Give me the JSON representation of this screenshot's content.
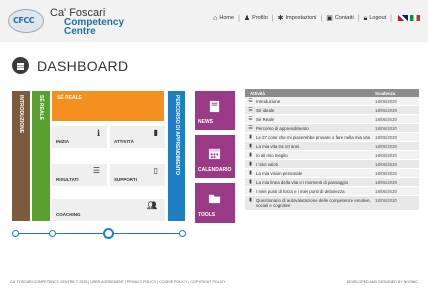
{
  "logo": {
    "badge": "CFCC",
    "line1": "Ca' Foscari",
    "line2": "Competency",
    "line3": "Centre"
  },
  "topnav": {
    "home": "Home",
    "profilo": "Profilo",
    "impostazioni": "Impostazioni",
    "contatti": "Contatti",
    "logout": "Logout"
  },
  "page": {
    "title": "DASHBOARD"
  },
  "strips": {
    "introduzione": "INTRODUZIONE",
    "se_reale": "SÉ REALE",
    "percorso": "PERCORSO DI APPRENDIMENTO"
  },
  "orange_block": {
    "label": "SÉ REALE"
  },
  "tiles": {
    "inizia": "INIZIA",
    "attivita": "ATTIVITÀ",
    "risultati": "RISULTATI",
    "supporti": "SUPPORTI",
    "coaching": "COACHING"
  },
  "widgets": {
    "news": "NEWS",
    "calendario": "CALENDARIO",
    "tools": "TOOLS"
  },
  "table": {
    "headers": [
      "Attività",
      "Scadenza"
    ],
    "rows": [
      {
        "icon": "list-icon",
        "title": "Introduzione",
        "date": "18/05/2020"
      },
      {
        "icon": "list-icon",
        "title": "Sé ideale",
        "date": "18/05/2020"
      },
      {
        "icon": "list-icon",
        "title": "Sé Reale",
        "date": "18/05/2020"
      },
      {
        "icon": "list-icon",
        "title": "Percorso di apprendimento",
        "date": "18/05/2020"
      },
      {
        "icon": "document-icon",
        "title": "Le 27 cose che mi piacerebbe provare o fare nella mia vita",
        "date": "18/05/2020"
      },
      {
        "icon": "document-icon",
        "title": "La mia vita tra 10 anni",
        "date": "18/05/2020"
      },
      {
        "icon": "document-icon",
        "title": "Io ali mio meglio",
        "date": "18/05/2020"
      },
      {
        "icon": "document-icon",
        "title": "I miei valori",
        "date": "18/05/2020"
      },
      {
        "icon": "document-icon",
        "title": "La mia vision personale",
        "date": "18/05/2020"
      },
      {
        "icon": "document-icon",
        "title": "La mia linea della vita e i momenti di passaggio",
        "date": "18/05/2020"
      },
      {
        "icon": "document-icon",
        "title": "I miei punti di forza e i miei punti di debolezza",
        "date": "18/05/2020"
      },
      {
        "icon": "document-icon",
        "title": "Questionario di autovalutazione delle competenze emotive, sociali e cognitive",
        "date": "18/05/2020"
      }
    ]
  },
  "footer": {
    "left": "CA' FOSCARI COMPETENCY CENTRE © 2015  |  USER AGREEMENT  |  PRIVACY POLICY  |  COOKIE POLICY  |  COPYRIGHT POLICY",
    "right": "DEVELOPED AND DESIGNED BY NOONIC"
  },
  "colors": {
    "introduzione": "#7b5a3e",
    "se_reale": "#5aa030",
    "orange": "#f39020",
    "percorso": "#1f7fc4",
    "widgets": "#9a3a86"
  }
}
